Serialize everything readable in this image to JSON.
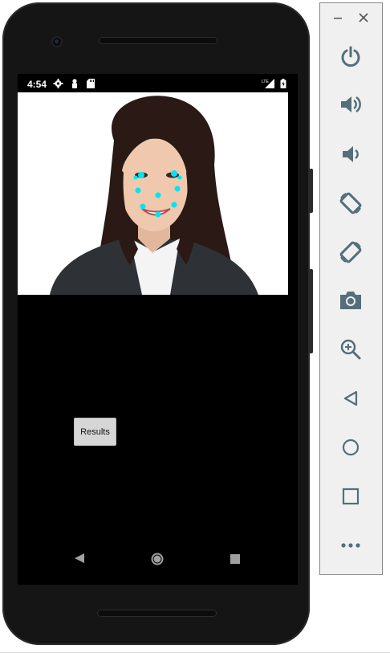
{
  "status_bar": {
    "time": "4:54",
    "left_icons": [
      "gear-icon",
      "person-icon",
      "sd-card-icon"
    ],
    "right_icons": [
      "lte-signal-icon",
      "battery-icon"
    ]
  },
  "photo": {
    "landmark_color": "#00e5f0",
    "landmark_count": 10
  },
  "app": {
    "results_label": "Results"
  },
  "nav_bar": {
    "icons": [
      "back-icon",
      "home-icon",
      "recents-icon"
    ]
  },
  "emulator_toolbar": {
    "accent": "#546e7a",
    "window_controls": [
      "minimize-icon",
      "close-icon"
    ],
    "buttons": [
      "power-icon",
      "volume-up-icon",
      "volume-down-icon",
      "rotate-left-icon",
      "rotate-right-icon",
      "camera-icon",
      "zoom-icon",
      "back-icon",
      "home-icon",
      "overview-icon",
      "more-icon"
    ]
  }
}
